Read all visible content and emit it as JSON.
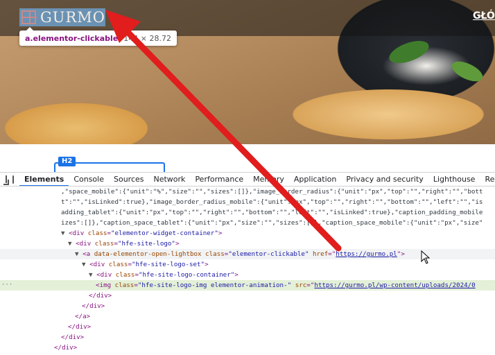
{
  "site": {
    "logo_text": "GURMO",
    "nav_link": "GŁÓW",
    "tooltip": {
      "selector": "a.elementor-clickable",
      "size": "144 × 28.72"
    },
    "heading_badge": "H2"
  },
  "devtools": {
    "tabs": [
      "Elements",
      "Console",
      "Sources",
      "Network",
      "Performance",
      "Memory",
      "Application",
      "Privacy and security",
      "Lighthouse",
      "Reco"
    ],
    "active_tab": "Elements",
    "lines": [
      {
        "indent": 0,
        "text": ",\"space_mobile\":{\"unit\":\"%\",\"size\":\"\",\"sizes\":[]},\"image_border_radius\":{\"unit\":\"px\",\"top\":\"\",\"right\":\"\",\"bott"
      },
      {
        "indent": 0,
        "text": "t\":\"\",\"isLinked\":true},\"image_border_radius_mobile\":{\"unit\":\"px\",\"top\":\"\",\"right\":\"\",\"bottom\":\"\",\"left\":\"\",\"is"
      },
      {
        "indent": 0,
        "text": "adding_tablet\":{\"unit\":\"px\",\"top\":\"\",\"right\":\"\",\"bottom\":\"\",\"left\":\"\",\"isLinked\":true},\"caption_padding_mobile"
      },
      {
        "indent": 0,
        "text": "izes\":[]},\"caption_space_tablet\":{\"unit\":\"px\",\"size\":\"\",\"sizes\":[]},\"caption_space_mobile\":{\"unit\":\"px\",\"size\""
      },
      {
        "tri": "▼",
        "tag_open": "<div ",
        "attr": "class",
        "eq": "=",
        "val": "\"elementor-widget-container\"",
        "close": ">"
      },
      {
        "tri": "▼",
        "tag_open": "<div ",
        "attr": "class",
        "eq": "=",
        "val": "\"hfe-site-logo\"",
        "close": ">"
      },
      {
        "tri": "▼",
        "tag_open": "<a ",
        "attr": "data-elementor-open-lightbox class",
        "eq": "=",
        "val": "\"elementor-clickable\"",
        "attr2": " href",
        "eq2": "=",
        "url": "https://gurmo.pl",
        "close": "\">"
      },
      {
        "tri": "▼",
        "tag_open": "<div ",
        "attr": "class",
        "eq": "=",
        "val": "\"hfe-site-logo-set\"",
        "close": ">"
      },
      {
        "tri": "▼",
        "tag_open": "<div ",
        "attr": "class",
        "eq": "=",
        "val": "\"hfe-site-logo-container\"",
        "close": ">"
      },
      {
        "tri": "",
        "tag_open": "<img ",
        "attr": "class",
        "eq": "=",
        "val": "\"hfe-site-logo-img elementor-animation-\"",
        "attr2": " src",
        "eq2": "=",
        "url": "https://gurmo.pl/wp-content/uploads/2024/0",
        "close": ""
      },
      {
        "tag_close": "</div>"
      },
      {
        "tag_close": "</div>"
      },
      {
        "tag_close": "</a>"
      },
      {
        "tag_close": "</div>"
      },
      {
        "tag_close": "</div>"
      },
      {
        "tag_close": "</div>"
      },
      {
        "tag_close": "<!--"
      }
    ],
    "gutter_marker": "···"
  },
  "colors": {
    "arrow": "#e11d1d",
    "tag": "#881280",
    "attr": "#994500",
    "value": "#1a1aa6",
    "selection": "#1a73e8"
  }
}
